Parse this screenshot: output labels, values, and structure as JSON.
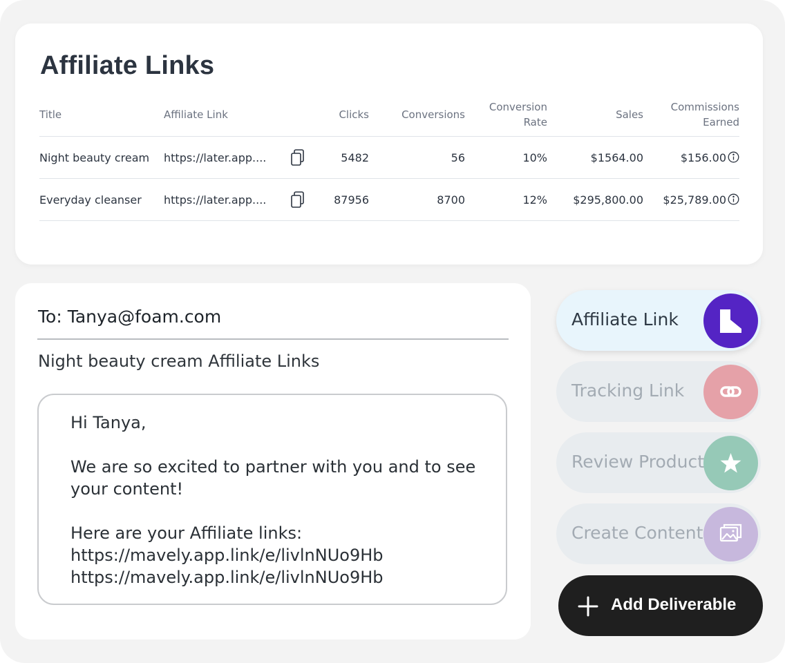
{
  "table": {
    "title": "Affiliate Links",
    "headers": {
      "title": "Title",
      "link": "Affiliate Link",
      "clicks": "Clicks",
      "conversions": "Conversions",
      "rate_1": "Conversion",
      "rate_2": "Rate",
      "sales": "Sales",
      "commissions_1": "Commissions",
      "commissions_2": "Earned"
    },
    "rows": [
      {
        "title": "Night beauty cream",
        "link": "https://later.app....",
        "clicks": "5482",
        "conversions": "56",
        "rate": "10%",
        "sales": "$1564.00",
        "commissions": "$156.00"
      },
      {
        "title": "Everyday cleanser",
        "link": "https://later.app....",
        "clicks": "87956",
        "conversions": "8700",
        "rate": "12%",
        "sales": "$295,800.00",
        "commissions": "$25,789.00"
      }
    ]
  },
  "email": {
    "to": "To: Tanya@foam.com",
    "subject": "Night beauty cream Affiliate Links",
    "greeting": "Hi Tanya,",
    "paragraph": "We are so excited to partner with you and to see your content!",
    "links_intro": "Here are your Affiliate links:",
    "link_1": "https://mavely.app.link/e/livlnNUo9Hb",
    "link_2": "https://mavely.app.link/e/livlnNUo9Hb"
  },
  "deliverables": [
    {
      "label": "Affiliate Link",
      "icon": "document-icon",
      "color": "#5424c4",
      "active": true
    },
    {
      "label": "Tracking Link",
      "icon": "link-icon",
      "color": "#e5a1a8",
      "active": false
    },
    {
      "label": "Review Product",
      "icon": "star-icon",
      "color": "#96c9b7",
      "active": false
    },
    {
      "label": "Create Content",
      "icon": "image-icon",
      "color": "#c7b8dd",
      "active": false
    }
  ],
  "add_button": {
    "label": "Add Deliverable",
    "icon": "plus-icon"
  },
  "colors": {
    "background": "#f3f3f3",
    "card": "#ffffff",
    "text": "#2c3440",
    "button": "#1f1f1f"
  }
}
